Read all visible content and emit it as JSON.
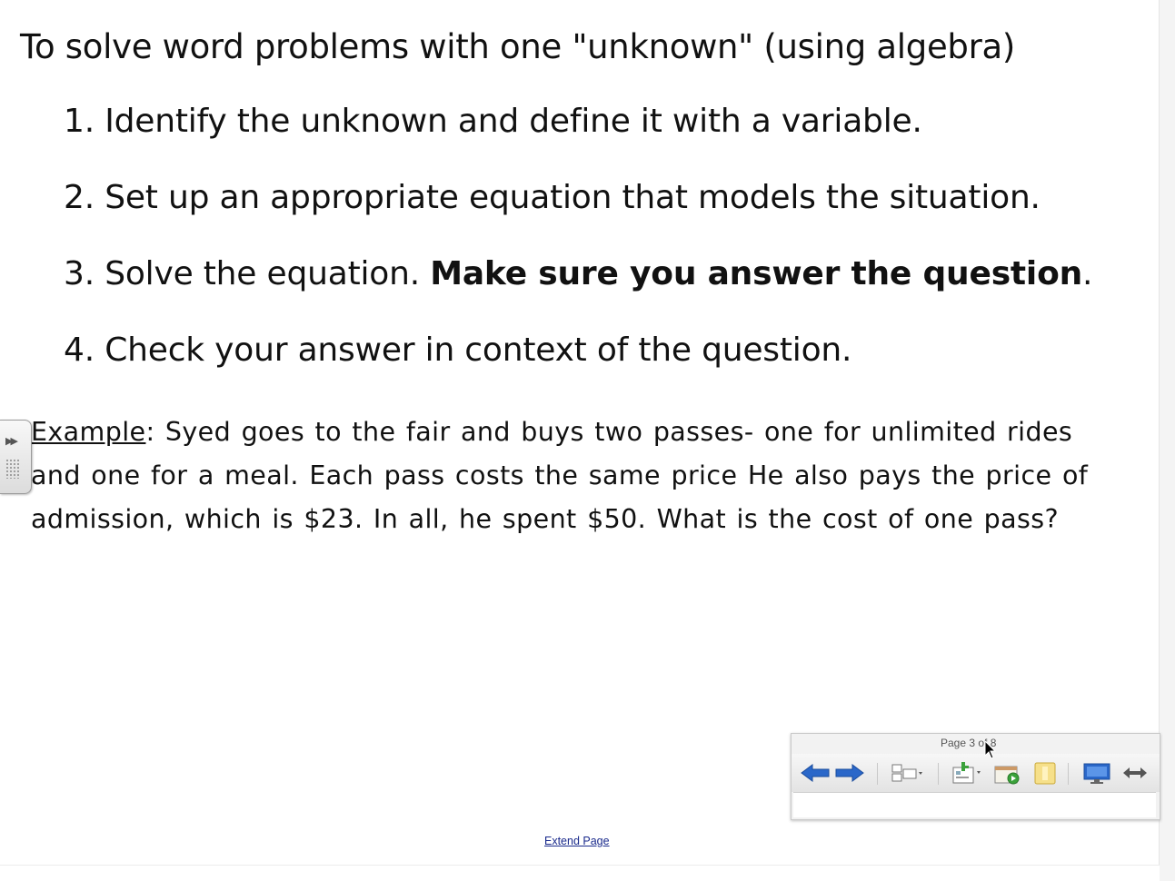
{
  "lesson": {
    "title": "To solve word problems with one \"unknown\" (using algebra)",
    "steps": [
      {
        "text": "1. Identify the unknown and define it with a variable."
      },
      {
        "text": "2. Set up an appropriate equation that models the situation."
      },
      {
        "text": "3. Solve the equation. ",
        "bold": "Make sure you answer the question",
        "tail": "."
      },
      {
        "text": "4. Check your answer in context of the question."
      }
    ],
    "example": {
      "label": "Example",
      "colon": ":",
      "line1": " Syed goes to the fair and buys two passes- one for unlimited rides",
      "line2": "and one for a meal. Each pass costs the same price He also pays the price of",
      "line3": "admission, which is $23. In all, he spent $50. What is the cost of one pass?"
    }
  },
  "toolbar": {
    "page_indicator": "Page 3 of 8",
    "icons": [
      "back-arrow-icon",
      "forward-arrow-icon",
      "page-sorter-icon",
      "insert-page-icon",
      "media-icon",
      "note-icon",
      "display-screen-icon",
      "move-toolbar-icon"
    ],
    "accent": "#2a67c9"
  },
  "side_tab": {
    "icons": [
      "expand-arrows-icon",
      "drag-grip-icon"
    ]
  },
  "footer": {
    "extend_page": "Extend Page"
  }
}
